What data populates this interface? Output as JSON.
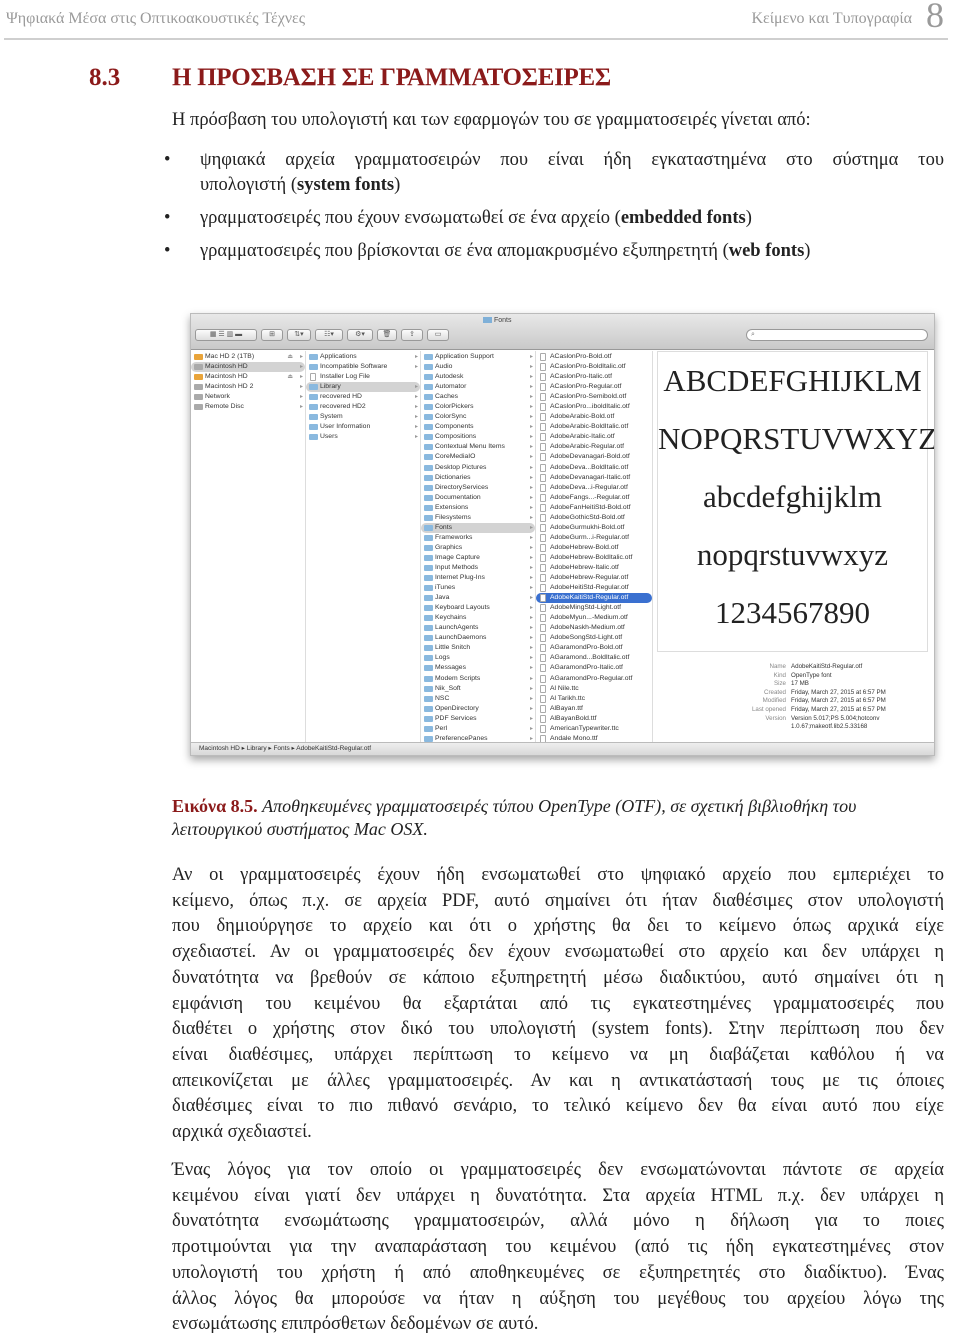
{
  "header": {
    "book_title": "Ψηφιακά Μέσα στις  Οπτικοακουστικές Τέχνες",
    "chapter_title": "Κείμενο και Τυπογραφία",
    "chapter_number": "8"
  },
  "section": {
    "number": "8.3",
    "title": "Η ΠΡΟΣΒΑΣΗ ΣΕ ΓΡΑΜΜΑΤΟΣΕΙΡΕΣ"
  },
  "intro": "Η πρόσβαση του υπολογιστή και των εφαρμογών του σε γραμματοσειρές γίνεται από:",
  "bullets": [
    {
      "lines": [
        "ψηφιακά αρχεία γραμματοσειρών που είναι ήδη εγκαταστημένα στο σύστημα του",
        "υπολογιστή ("
      ],
      "bold": "system fonts",
      "end": ")"
    },
    {
      "text": "γραμματοσειρές που έχουν ενσωματωθεί σε ένα αρχείο (",
      "bold": "embedded fonts",
      "end": ")"
    },
    {
      "text": "γραμματοσειρές που βρίσκονται σε ένα απομακρυσμένο εξυπηρετητή (",
      "bold": "web fonts",
      "end": ")"
    }
  ],
  "finder": {
    "window_title": "Fonts",
    "search_placeholder": "",
    "sidebar": [
      {
        "label": "Mac HD 2 (1TB)",
        "type": "ext",
        "eject": true
      },
      {
        "label": "Macintosh HD",
        "type": "drive",
        "selected": true
      },
      {
        "label": "Macintosh HD",
        "type": "ext",
        "eject": true
      },
      {
        "label": "Macintosh HD 2",
        "type": "drive"
      },
      {
        "label": "Network",
        "type": "drive"
      },
      {
        "label": "Remote Disc",
        "type": "drive"
      }
    ],
    "root_items": [
      "Applications",
      "Incompatible Software",
      "Installer Log File",
      "Library",
      "recovered HD",
      "recovered HD2",
      "System",
      "User Information",
      "Users"
    ],
    "root_selected": "Library",
    "library_items": [
      "Application Support",
      "Audio",
      "Autodesk",
      "Automator",
      "Caches",
      "ColorPickers",
      "ColorSync",
      "Components",
      "Compositions",
      "Contextual Menu Items",
      "CoreMediaIO",
      "Desktop Pictures",
      "Dictionaries",
      "DirectoryServices",
      "Documentation",
      "Extensions",
      "Filesystems",
      "Fonts",
      "Frameworks",
      "Graphics",
      "Image Capture",
      "Input Methods",
      "Internet Plug-Ins",
      "iTunes",
      "Java",
      "Keyboard Layouts",
      "Keychains",
      "LaunchAgents",
      "LaunchDaemons",
      "Little Snitch",
      "Logs",
      "Messages",
      "Modem Scripts",
      "Nik_Soft",
      "NSC",
      "OpenDirectory",
      "PDF Services",
      "Perl",
      "PreferencePanes"
    ],
    "library_selected": "Fonts",
    "font_files": [
      "ACaslonPro-Bold.otf",
      "ACaslonPro-BoldItalic.otf",
      "ACaslonPro-Italic.otf",
      "ACaslonPro-Regular.otf",
      "ACaslonPro-Semibold.otf",
      "ACaslonPro...iboldItalic.otf",
      "AdobeArabic-Bold.otf",
      "AdobeArabic-BoldItalic.otf",
      "AdobeArabic-Italic.otf",
      "AdobeArabic-Regular.otf",
      "AdobeDevanagari-Bold.otf",
      "AdobeDeva...BoldItalic.otf",
      "AdobeDevanagari-Italic.otf",
      "AdobeDeva...i-Regular.otf",
      "AdobeFangs...-Regular.otf",
      "AdobeFanHeitiStd-Bold.otf",
      "AdobeGothicStd-Bold.otf",
      "AdobeGurmukhi-Bold.otf",
      "AdobeGurm...i-Regular.otf",
      "AdobeHebrew-Bold.otf",
      "AdobeHebrew-BoldItalic.otf",
      "AdobeHebrew-Italic.otf",
      "AdobeHebrew-Regular.otf",
      "AdobeHeitiStd-Regular.otf",
      "AdobeKaitiStd-Regular.otf",
      "AdobeMingStd-Light.otf",
      "AdobeMyun...-Medium.otf",
      "AdobeNaskh-Medium.otf",
      "AdobeSongStd-Light.otf",
      "AGaramondPro-Bold.otf",
      "AGaramond...BoldItalic.otf",
      "AGaramondPro-Italic.otf",
      "AGaramondPro-Regular.otf",
      "Al Nile.ttc",
      "Al Tarikh.ttc",
      "AlBayan.ttf",
      "AlBayanBold.ttf",
      "AmericanTypewriter.ttc",
      "Andale Mono.ttf"
    ],
    "font_selected": "AdobeKaitiStd-Regular.otf",
    "preview_lines": [
      "ABCDEFGHIJKLM",
      "NOPQRSTUVWXYZ",
      "abcdefghijklm",
      "nopqrstuvwxyz",
      "1234567890"
    ],
    "metadata": [
      {
        "key": "Name",
        "value": "AdobeKaitiStd-Regular.otf"
      },
      {
        "key": "Kind",
        "value": "OpenType font"
      },
      {
        "key": "Size",
        "value": "17 MB"
      },
      {
        "key": "Created",
        "value": "Friday, March 27, 2015 at 6:57 PM"
      },
      {
        "key": "Modified",
        "value": "Friday, March 27, 2015 at 6:57 PM"
      },
      {
        "key": "Last opened",
        "value": "Friday, March 27, 2015 at 6:57 PM"
      },
      {
        "key": "Version",
        "value": "Version 5.017;PS 5.004;hotconv 1.0.67;makeotf.lib2.5.33168"
      }
    ],
    "path": [
      "Macintosh HD",
      "Library",
      "Fonts",
      "AdobeKaitiStd-Regular.otf"
    ]
  },
  "caption": {
    "label": "Εικόνα 8.5.",
    "lines": [
      "Αποθηκευμένες γραμματοσειρές τύπου OpenType (OTF), σε σχετική βιβλιοθήκη του",
      "λειτουργικού συστήματος Mac OSX."
    ]
  },
  "paragraphs": [
    [
      "Αν οι γραμματοσειρές έχουν ήδη ενσωματωθεί στο ψηφιακό αρχείο που εμπεριέχει το",
      "κείμενο, όπως π.χ. σε αρχεία PDF, αυτό σημαίνει ότι ήταν διαθέσιμες στον υπολογιστή",
      "που δημιούργησε το αρχείο και ότι ο χρήστης θα δει το κείμενο όπως αρχικά είχε",
      "σχεδιαστεί.  Αν οι γραμματοσειρές δεν έχουν ενσωματωθεί στο αρχείο και δεν υπάρχει η",
      "δυνατότητα να βρεθούν σε κάποιο εξυπηρετητή μέσω διαδικτύου, αυτό σημαίνει ότι η",
      "εμφάνιση του κειμένου θα εξαρτάται από τις εγκατεστημένες γραμματοσειρές που",
      "διαθέτει ο χρήστης στον δικό του υπολογιστή (system fonts). Στην περίπτωση που δεν",
      "είναι διαθέσιμες, υπάρχει περίπτωση το κείμενο να μη διαβάζεται καθόλου ή να",
      "απεικονίζεται με άλλες γραμματοσειρές. Αν και η αντικατάστασή τους με τις όποιες",
      "διαθέσιμες είναι το πιο πιθανό σενάριο, το τελικό κείμενο δεν θα είναι αυτό που είχε",
      "αρχικά σχεδιαστεί."
    ],
    [
      "Ένας λόγος για τον οποίο οι γραμματοσειρές δεν ενσωματώνονται πάντοτε σε αρχεία",
      "κειμένου είναι γιατί δεν υπάρχει η δυνατότητα. Στα αρχεία HTML π.χ. δεν υπάρχει η",
      "δυνατότητα ενσωμάτωσης γραμματοσειρών, αλλά μόνο η δήλωση για το ποιες",
      "προτιμούνται για την αναπαράσταση του κειμένου (από τις ήδη εγκατεστημένες στον",
      "υπολογιστή του χρήστη ή από αποθηκευμένες σε εξυπηρετητές στο διαδίκτυο). Ένας",
      "άλλος λόγος θα μπορούσε να ήταν η αύξηση του μεγέθους του αρχείου λόγω της",
      "ενσωμάτωσης επιπρόσθετων δεδομένων σε αυτό."
    ]
  ],
  "colors": {
    "heading": "#8b1a1a",
    "header_text": "#9a9a9a",
    "selection": "#3a70d0"
  }
}
